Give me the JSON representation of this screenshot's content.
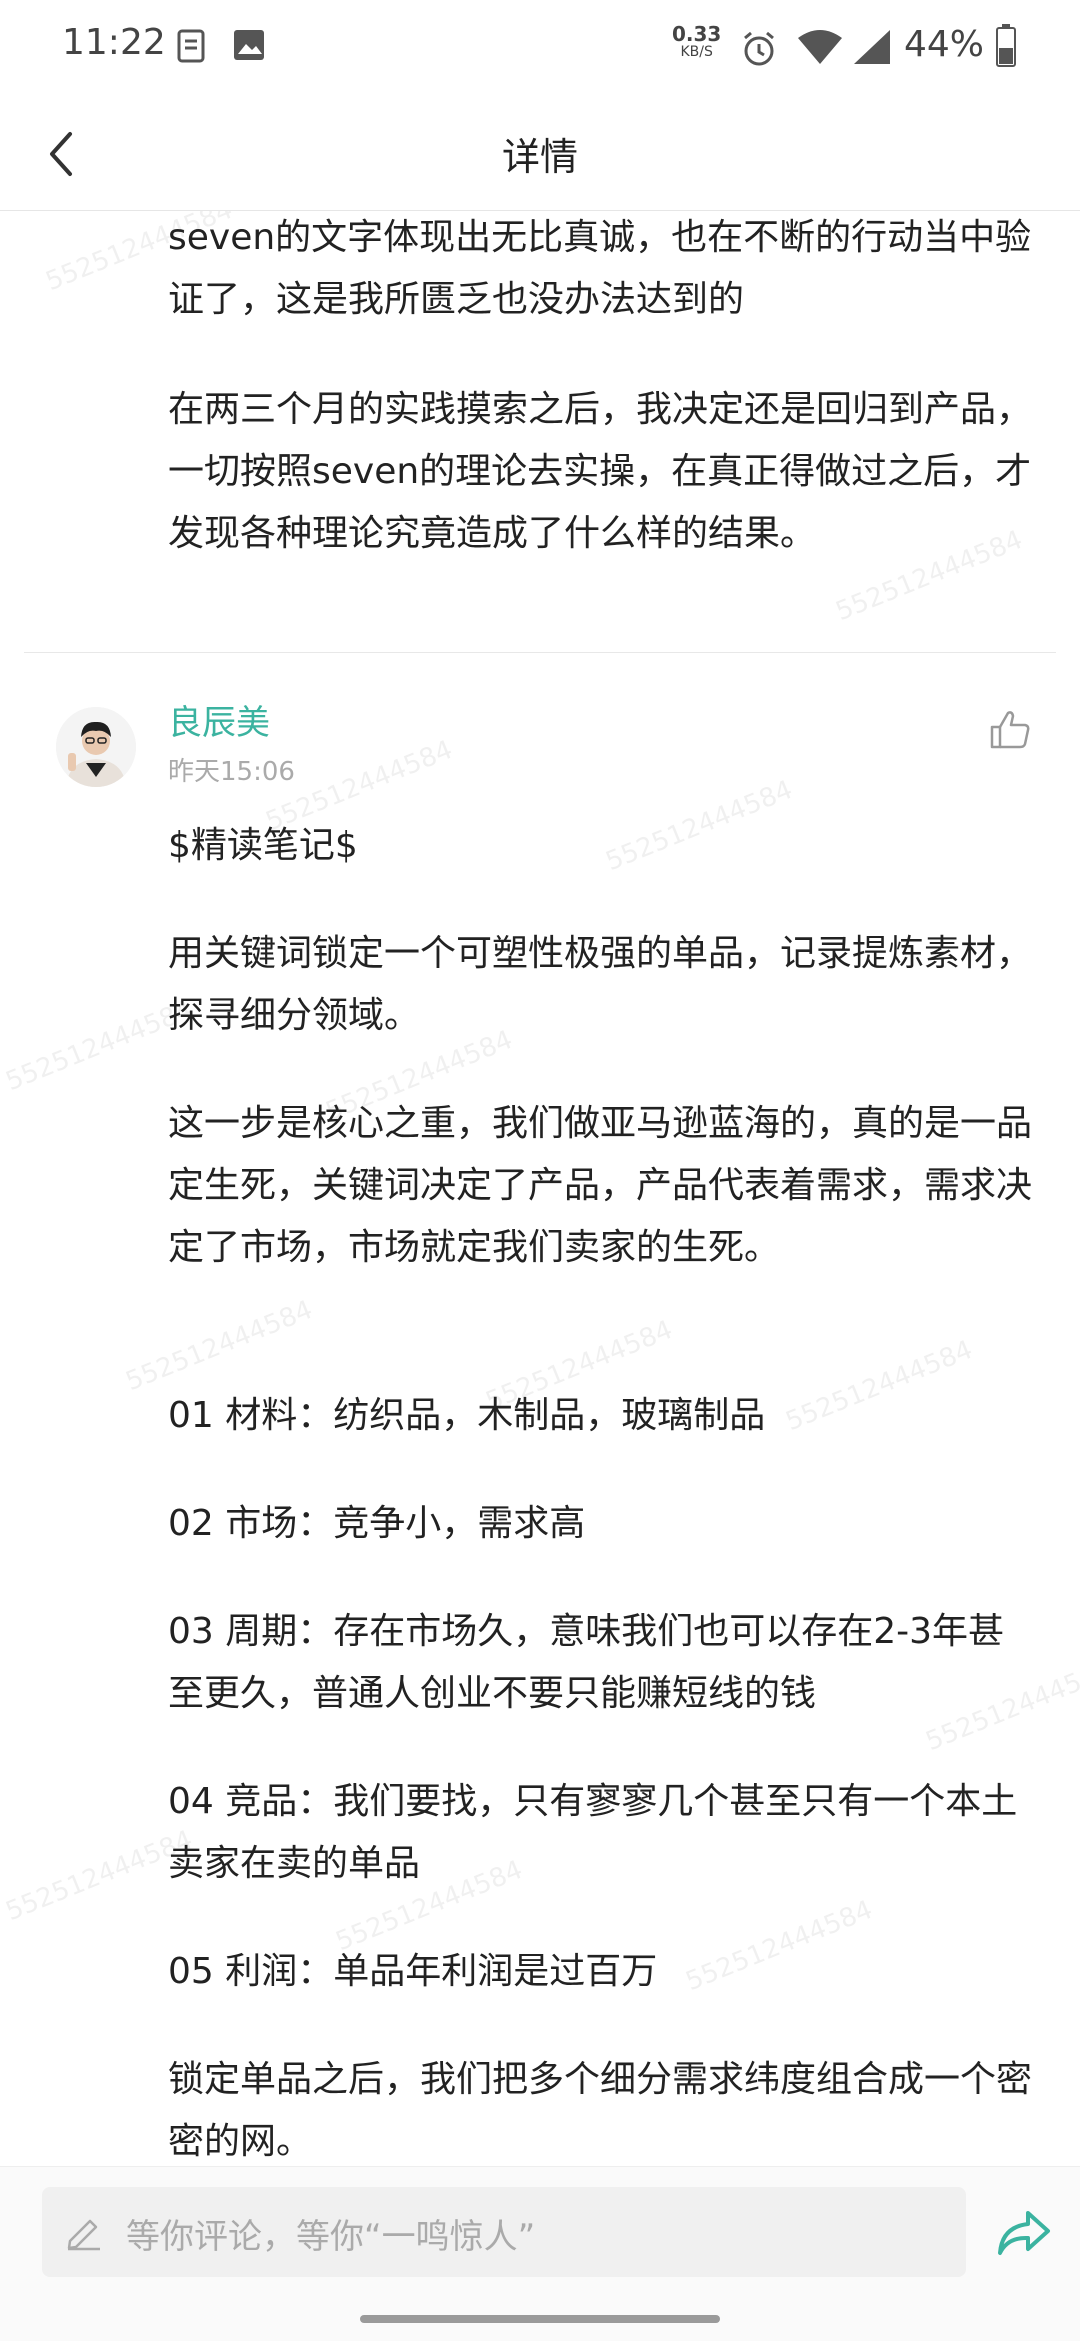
{
  "status_bar": {
    "time": "11:22",
    "speed_value": "0.33",
    "speed_unit": "KB/S",
    "battery": "44%"
  },
  "header": {
    "title": "详情"
  },
  "first_comment": {
    "paragraphs": [
      "seven的文字体现出无比真诚，也在不断的行动当中验证了，这是我所匮乏也没办法达到的",
      "在两三个月的实践摸索之后，我决定还是回归到产品，一切按照seven的理论去实操，在真正得做过之后，才发现各种理论究竟造成了什么样的结果。"
    ]
  },
  "second_comment": {
    "username": "良辰美",
    "time": "昨天15:06",
    "paragraphs": [
      "$精读笔记$",
      "用关键词锁定一个可塑性极强的单品，记录提炼素材，探寻细分领域。",
      "这一步是核心之重，我们做亚马逊蓝海的，真的是一品定生死，关键词决定了产品，产品代表着需求，需求决定了市场，市场就定我们卖家的生死。",
      "01  材料：纺织品，木制品，玻璃制品",
      "02  市场：竞争小，需求高",
      "03  周期：存在市场久，意味我们也可以存在2-3年甚至更久，普通人创业不要只能赚短线的钱",
      "04  竞品：我们要找，只有寥寥几个甚至只有一个本土卖家在卖的单品",
      "05  利润：单品年利润是过百万",
      "锁定单品之后，我们把多个细分需求纬度组合成一个密密的网。"
    ]
  },
  "watermark": "552512444584",
  "bottom_bar": {
    "comment_placeholder": "等你评论，等你“一鸣惊人”"
  },
  "colors": {
    "accent": "#3bb3a0",
    "text": "#222222",
    "muted": "#aaaaaa"
  },
  "icons": [
    "document-icon",
    "image-icon",
    "alarm-icon",
    "wifi-icon",
    "signal-icon",
    "battery-icon",
    "back-arrow-icon",
    "thumbs-up-icon",
    "pen-icon",
    "share-icon"
  ]
}
